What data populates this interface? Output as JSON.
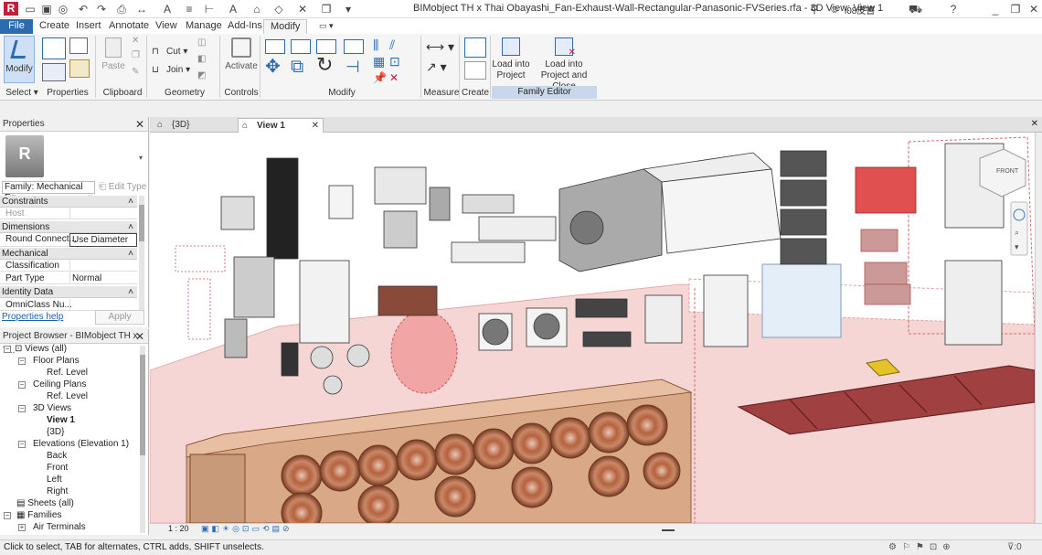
{
  "title": "BIMobject TH x Thai Obayashi_Fan-Exhaust-Wall-Rectangular-Panasonic-FVSeries.rfa - 3D View: View 1",
  "user": "i08皮書",
  "menu": [
    "File",
    "Create",
    "Insert",
    "Annotate",
    "View",
    "Manage",
    "Add-Ins",
    "Modify"
  ],
  "ribbon": {
    "modify": "Modify",
    "paste": "Paste",
    "cut": "Cut",
    "join": "Join",
    "activate": "Activate",
    "load_project": [
      "Load into",
      "Project"
    ],
    "load_close": [
      "Load into",
      "Project and Close"
    ],
    "groups": [
      "Select",
      "Properties",
      "Clipboard",
      "Geometry",
      "Controls",
      "Modify",
      "Measure",
      "Create",
      "Family Editor"
    ]
  },
  "properties": {
    "header": "Properties",
    "family": "Family: Mechanical Eq",
    "edit_type": "Edit Type",
    "sections": [
      {
        "name": "Constraints",
        "rows": [
          {
            "k": "Host",
            "v": ""
          }
        ]
      },
      {
        "name": "Dimensions",
        "rows": [
          {
            "k": "Round Connect...",
            "v": "Use Diameter"
          }
        ]
      },
      {
        "name": "Mechanical",
        "rows": [
          {
            "k": "Classification",
            "v": ""
          },
          {
            "k": "Part Type",
            "v": "Normal"
          }
        ]
      },
      {
        "name": "Identity Data",
        "rows": [
          {
            "k": "OmniClass Nu...",
            "v": ""
          }
        ]
      }
    ],
    "help": "Properties help",
    "apply": "Apply"
  },
  "browser": {
    "header": "Project Browser - BIMobject TH x T...",
    "items": [
      "Views (all)",
      "Floor Plans",
      "Ref. Level",
      "Ceiling Plans",
      "Ref. Level",
      "3D Views",
      "View 1",
      "{3D}",
      "Elevations (Elevation 1)",
      "Back",
      "Front",
      "Left",
      "Right",
      "Sheets (all)",
      "Families",
      "Air Terminals"
    ]
  },
  "tabs": [
    "{3D}",
    "View 1"
  ],
  "viewcube": "FRONT",
  "scale": "1 : 20",
  "status": "Click to select, TAB for alternates, CTRL adds, SHIFT unselects.",
  "filter_count": ":0"
}
